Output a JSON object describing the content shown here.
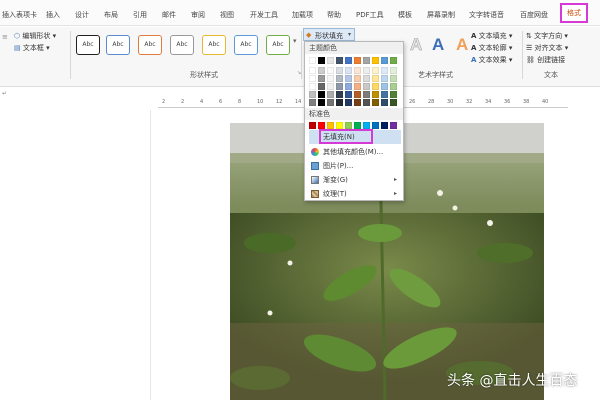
{
  "tabs": [
    "插入表项卡",
    "插入",
    "设计",
    "布局",
    "引用",
    "邮件",
    "审阅",
    "视图",
    "开发工具",
    "加载项",
    "帮助",
    "PDF工具",
    "模板",
    "屏幕录制",
    "文字转语音",
    "百度网盘",
    "格式"
  ],
  "ribbon": {
    "edit_shape": "编辑形状",
    "text_box": "文本框",
    "style_sample": "Abc",
    "shape_fill": "形状填充",
    "shape_styles_group": "形状样式",
    "art_styles_group": "艺术字样式",
    "art_letter": "A",
    "text_fill": "文本填充",
    "text_outline": "文本轮廓",
    "text_effects": "文本效果",
    "text_direction": "文字方向",
    "align_text": "对齐文本",
    "create_link": "创建链接",
    "text_group": "文本"
  },
  "dropdown": {
    "theme_colors_label": "主题颜色",
    "standard_colors_label": "标准色",
    "no_fill": "无填充(N)",
    "more_colors": "其他填充颜色(M)...",
    "picture": "图片(P)...",
    "gradient": "渐变(G)",
    "texture": "纹理(T)",
    "theme_colors": [
      "#ffffff",
      "#000000",
      "#e7e6e6",
      "#44546a",
      "#4472c4",
      "#ed7d31",
      "#a5a5a5",
      "#ffc000",
      "#5b9bd5",
      "#70ad47"
    ],
    "standard_colors": [
      "#c00000",
      "#ff0000",
      "#ffc000",
      "#ffff00",
      "#92d050",
      "#00b050",
      "#00b0f0",
      "#0070c0",
      "#002060",
      "#7030a0"
    ]
  },
  "ruler_numbers": [
    "2",
    "2",
    "4",
    "6",
    "8",
    "10",
    "12",
    "14",
    "16",
    "18",
    "20",
    "22",
    "24",
    "26",
    "28",
    "30",
    "32",
    "34",
    "36",
    "38",
    "40"
  ],
  "watermark": "头条 @直击人生百态",
  "colors": {
    "highlight": "#d53ad6",
    "accent": "#c84a00"
  }
}
